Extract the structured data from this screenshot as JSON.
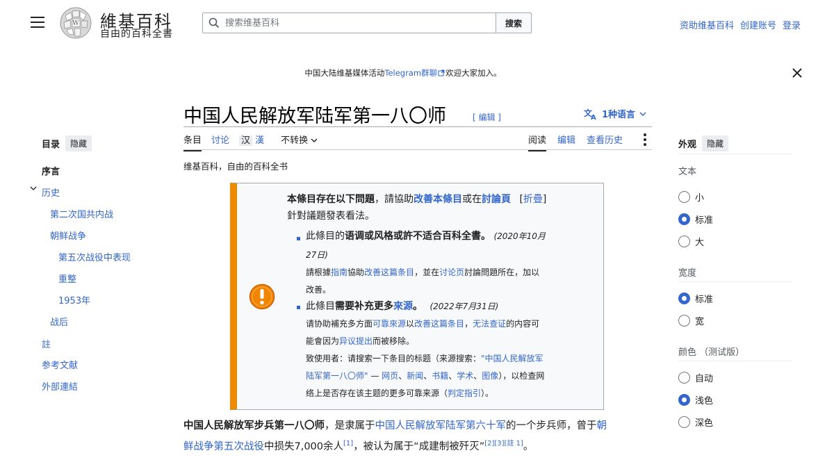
{
  "header": {
    "wordmark": "維基百科",
    "tagline": "自由的百科全書",
    "search_placeholder": "搜索维基百科",
    "search_button": "搜索",
    "donate": "资助维基百科",
    "create_account": "创建账号",
    "login": "登录"
  },
  "banner": {
    "prefix": "中国大陆维基媒体活动",
    "link": "Telegram群聊",
    "suffix": "欢迎大家加入。"
  },
  "page": {
    "title": "中国人民解放军陆军第一八〇师",
    "title_edit": "[ 编辑 ]",
    "languages": "1种语言",
    "from_wiki": "维基百科，自由的百科全书"
  },
  "tabs": {
    "article": "条目",
    "talk": "讨论",
    "hans": "汉",
    "hant": "漢",
    "variant": "不转换",
    "read": "阅读",
    "edit": "编辑",
    "history": "查看历史"
  },
  "toc": {
    "title": "目录",
    "hide": "隐藏",
    "items": [
      "序言",
      "历史",
      "第二次国共内战",
      "朝鲜战争",
      "第五次战役中表现",
      "重整",
      "1953年",
      "战后",
      "註",
      "参考文献",
      "外部連結"
    ]
  },
  "appearance": {
    "title": "外观",
    "hide": "隐藏",
    "text_label": "文本",
    "text_options": [
      "小",
      "标准",
      "大"
    ],
    "width_label": "宽度",
    "width_options": [
      "标准",
      "宽"
    ],
    "color_label": "颜色",
    "color_beta": "（测试版）",
    "color_options": [
      "自动",
      "浅色",
      "深色"
    ],
    "selected": {
      "text": "标准",
      "width": "标准",
      "color": "浅色"
    }
  },
  "ambox": {
    "head_bold": "本條目存在以下問題",
    "head_mid": "，請協助",
    "head_link1": "改善本條目",
    "head_or": "或在",
    "head_link2": "討論頁",
    "head_collapse": "折疊",
    "head_tail": "針對議題發表看法。",
    "issue1_pre": "此條目的",
    "issue1_bold": "语调或风格或許不适合百科全書。",
    "issue1_date_a": "(2020年10月",
    "issue1_date_b": "27日)",
    "issue1_sub_a1": "請根據",
    "issue1_sub_link1": "指南",
    "issue1_sub_a2": "協助",
    "issue1_sub_link2": "改善这篇条目",
    "issue1_sub_a3": "，並在",
    "issue1_sub_link3": "讨论页",
    "issue1_sub_a4": "討論問題所在，加以",
    "issue1_sub_b": "改善。",
    "issue2_pre": "此條目",
    "issue2_bold": "需要补充更多",
    "issue2_link": "來源",
    "issue2_end": "。",
    "issue2_date": "(2022年7月31日)",
    "issue2_sub_a1": "请协助補充多方面",
    "issue2_sub_link1": "可靠來源",
    "issue2_sub_a2": "以",
    "issue2_sub_link2": "改善这篇条目",
    "issue2_sub_a3": "，",
    "issue2_sub_link3": "无法查证",
    "issue2_sub_a4": "的内容可",
    "issue2_sub_b1": "能會因为",
    "issue2_sub_link4": "异议提出",
    "issue2_sub_b2": "而被移除。",
    "issue2_sub_c1": "致使用者：请搜索一下条目的标题（来源搜索：",
    "issue2_sub_link5": "\"中国人民解放军",
    "issue2_sub_d_link": "陆军第一八〇师\"",
    "issue2_sub_d1": " — ",
    "issue2_sub_link6": "网页",
    "issue2_sub_link7": "新闻",
    "issue2_sub_link8": "书籍",
    "issue2_sub_link9": "学术",
    "issue2_sub_link10": "图像",
    "issue2_sub_d2": "），以检查网",
    "issue2_sub_e1": "络上是否存在该主题的更多可靠来源（",
    "issue2_sub_link11": "判定指引",
    "issue2_sub_e2": "）。"
  },
  "body": {
    "bold": "中国人民解放军步兵第一八〇师",
    "t1": "，是隶属于",
    "link1": "中国人民解放军陆军第六十军",
    "t2": "的一个步兵师，曾于",
    "link2a": "朝",
    "link2b": "鲜战争第五次战役",
    "t3": "中损失7,000余人",
    "ref1": "[1]",
    "t4": "，被认为属于“成建制被歼灭”",
    "ref2": "[2][3][註 1]",
    "t5": "。"
  }
}
